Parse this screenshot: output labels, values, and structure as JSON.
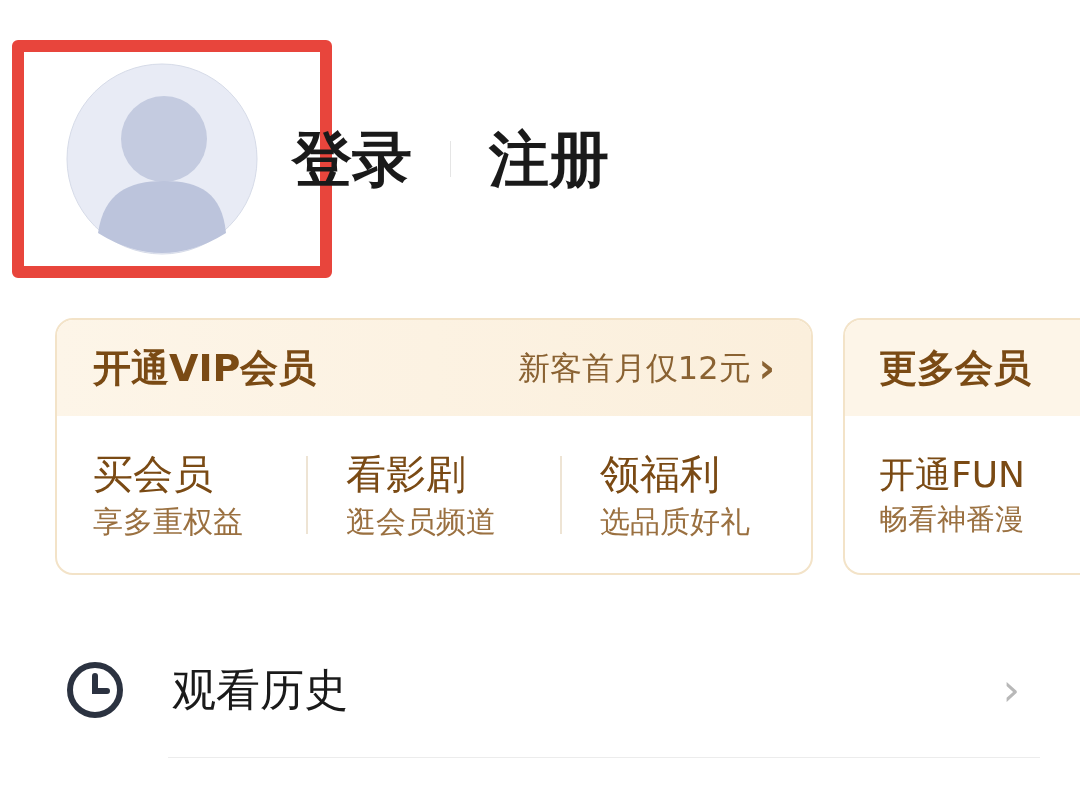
{
  "profile": {
    "login": "登录",
    "register": "注册",
    "highlighted": true
  },
  "vip_card": {
    "title": "开通VIP会员",
    "offer": "新客首月仅12元",
    "offer_arrow": "›",
    "items": [
      {
        "title": "买会员",
        "subtitle": "享多重权益"
      },
      {
        "title": "看影剧",
        "subtitle": "逛会员频道"
      },
      {
        "title": "领福利",
        "subtitle": "选品质好礼"
      }
    ]
  },
  "more_card": {
    "title": "更多会员",
    "items": [
      {
        "title": "开通FUN",
        "subtitle": "畅看神番漫"
      }
    ]
  },
  "menu": [
    {
      "label": "观看历史",
      "arrow": "›"
    }
  ]
}
